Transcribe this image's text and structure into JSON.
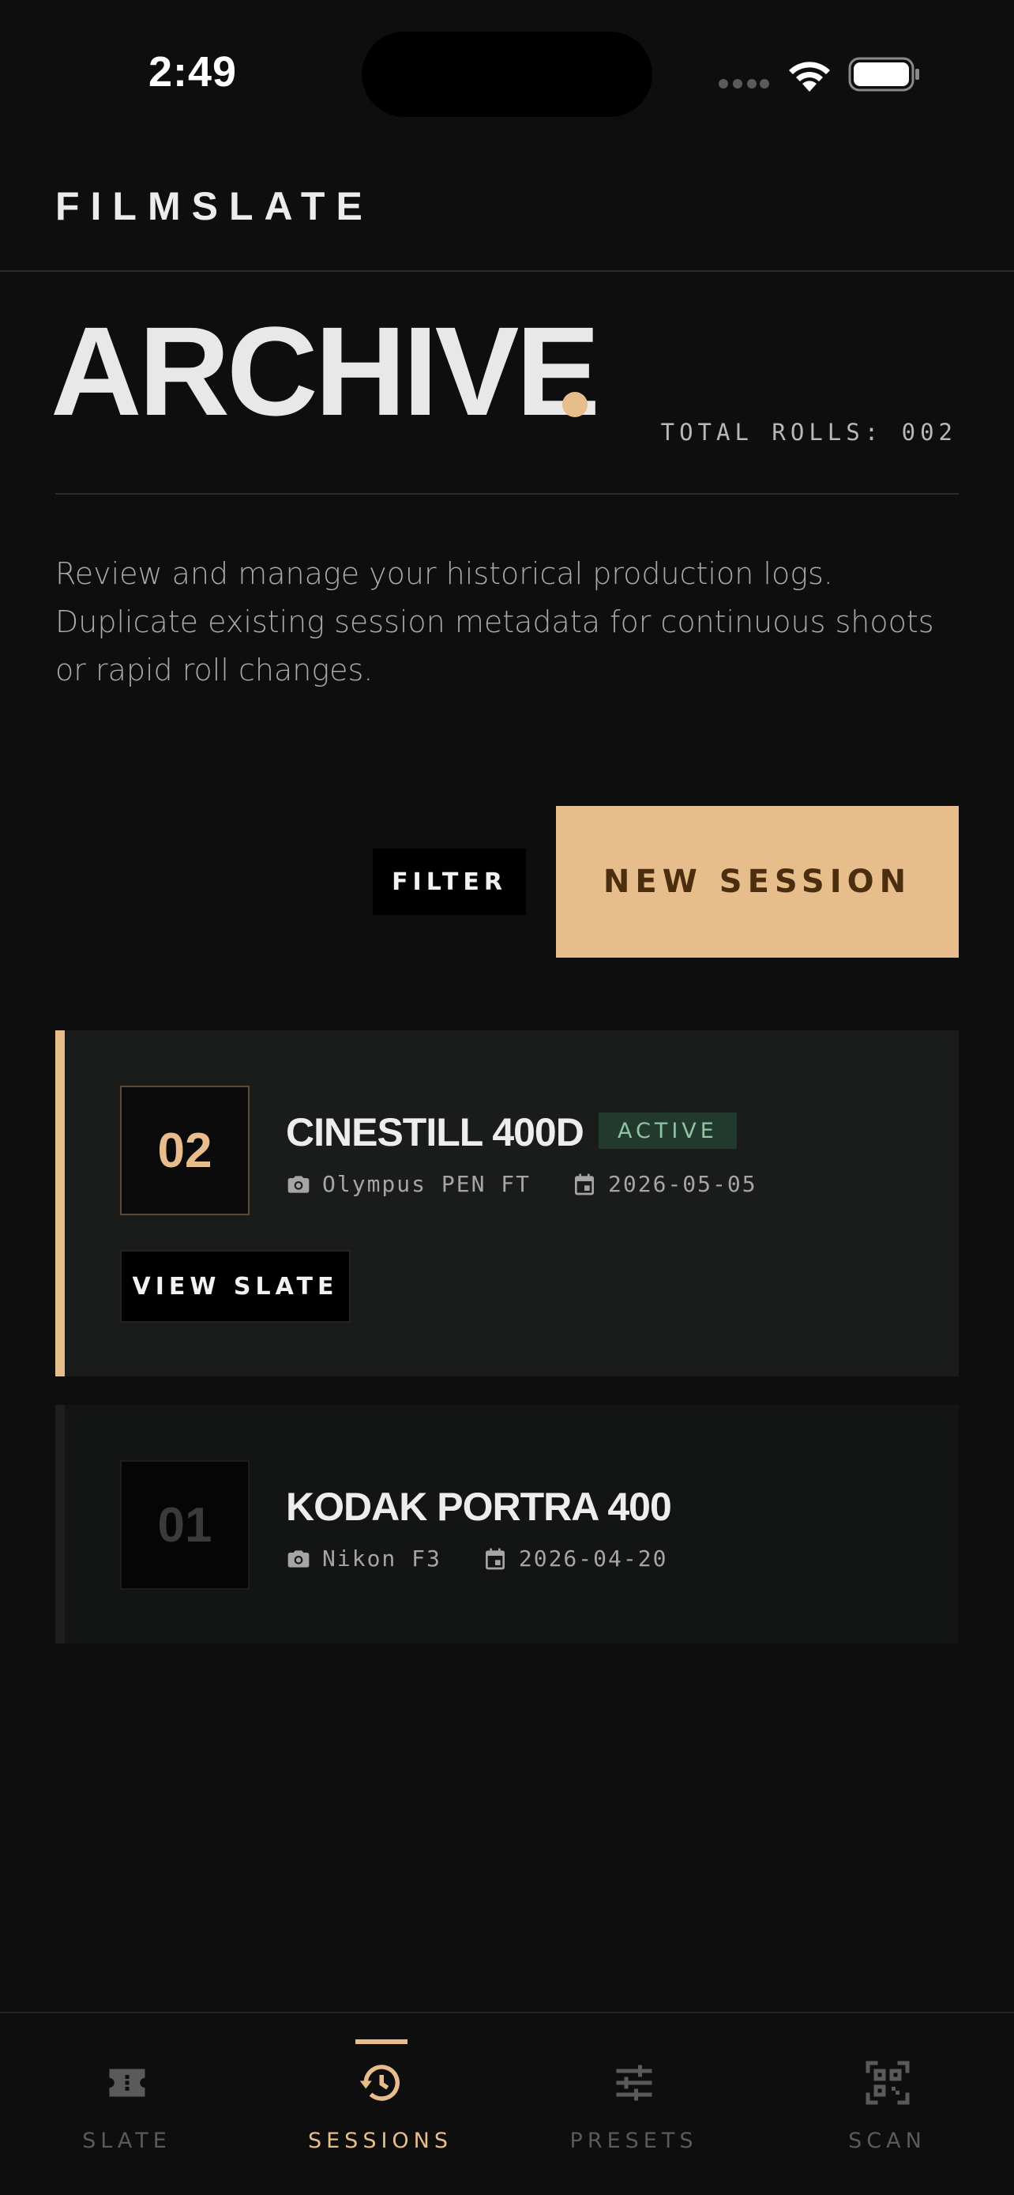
{
  "status_bar": {
    "time": "2:49"
  },
  "app": {
    "brand": "FILMSLATE"
  },
  "archive": {
    "title": "ARCHIVE",
    "total_rolls": "TOTAL ROLLS: 002",
    "description": "Review and manage your historical production logs. Duplicate existing session metadata for continuous shoots or rapid roll changes."
  },
  "actions": {
    "filter_label": "FILTER",
    "new_session_label": "NEW SESSION"
  },
  "sessions": [
    {
      "roll_number": "02",
      "film": "CINESTILL 400D",
      "status": "ACTIVE",
      "camera": "Olympus PEN FT",
      "date": "2026-05-05",
      "action_label": "VIEW SLATE"
    },
    {
      "roll_number": "01",
      "film": "KODAK PORTRA 400",
      "camera": "Nikon F3",
      "date": "2026-04-20"
    }
  ],
  "nav": {
    "items": [
      {
        "label": "SLATE",
        "icon": "ticket-icon"
      },
      {
        "label": "SESSIONS",
        "icon": "history-icon",
        "active": true
      },
      {
        "label": "PRESETS",
        "icon": "sliders-icon"
      },
      {
        "label": "SCAN",
        "icon": "qr-code-icon"
      }
    ]
  },
  "colors": {
    "accent": "#e8bd8c",
    "background": "#0e0e0e",
    "active_badge": "#223a2e"
  }
}
